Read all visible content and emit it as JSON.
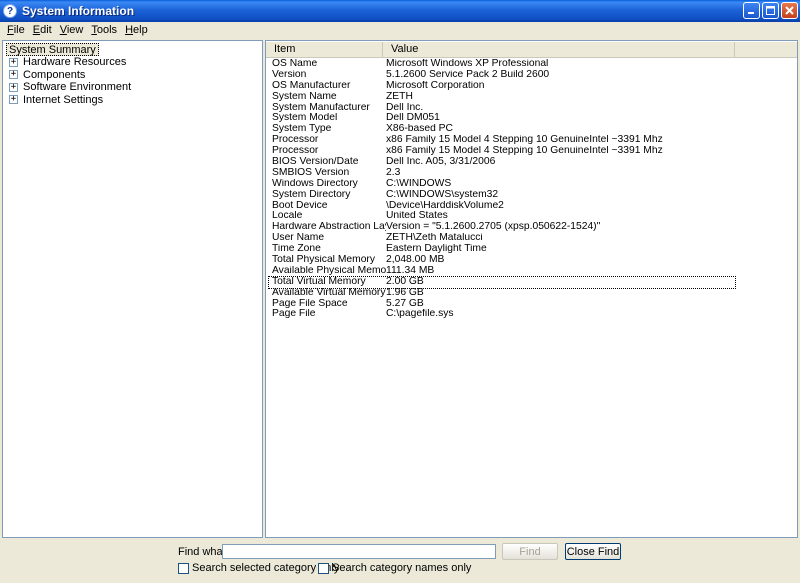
{
  "window": {
    "title": "System Information",
    "icon": "info-app-icon"
  },
  "menu": [
    {
      "label": "File",
      "accel": "F",
      "rest": "ile"
    },
    {
      "label": "Edit",
      "accel": "E",
      "rest": "dit"
    },
    {
      "label": "View",
      "accel": "V",
      "rest": "iew"
    },
    {
      "label": "Tools",
      "accel": "T",
      "rest": "ools"
    },
    {
      "label": "Help",
      "accel": "H",
      "rest": "elp"
    }
  ],
  "tree": {
    "root": "System Summary",
    "nodes": [
      "Hardware Resources",
      "Components",
      "Software Environment",
      "Internet Settings"
    ]
  },
  "table": {
    "columns": [
      "Item",
      "Value"
    ],
    "selected_index": 20,
    "rows": [
      [
        "OS Name",
        "Microsoft Windows XP Professional"
      ],
      [
        "Version",
        "5.1.2600 Service Pack 2 Build 2600"
      ],
      [
        "OS Manufacturer",
        "Microsoft Corporation"
      ],
      [
        "System Name",
        "ZETH"
      ],
      [
        "System Manufacturer",
        "Dell Inc."
      ],
      [
        "System Model",
        "Dell DM051"
      ],
      [
        "System Type",
        "X86-based PC"
      ],
      [
        "Processor",
        "x86 Family 15 Model 4 Stepping 10 GenuineIntel ~3391 Mhz"
      ],
      [
        "Processor",
        "x86 Family 15 Model 4 Stepping 10 GenuineIntel ~3391 Mhz"
      ],
      [
        "BIOS Version/Date",
        "Dell Inc. A05, 3/31/2006"
      ],
      [
        "SMBIOS Version",
        "2.3"
      ],
      [
        "Windows Directory",
        "C:\\WINDOWS"
      ],
      [
        "System Directory",
        "C:\\WINDOWS\\system32"
      ],
      [
        "Boot Device",
        "\\Device\\HarddiskVolume2"
      ],
      [
        "Locale",
        "United States"
      ],
      [
        "Hardware Abstraction Layer",
        "Version = \"5.1.2600.2705 (xpsp.050622-1524)\""
      ],
      [
        "User Name",
        "ZETH\\Zeth Matalucci"
      ],
      [
        "Time Zone",
        "Eastern Daylight Time"
      ],
      [
        "Total Physical Memory",
        "2,048.00 MB"
      ],
      [
        "Available Physical Memory",
        "111.34 MB"
      ],
      [
        "Total Virtual Memory",
        "2.00 GB"
      ],
      [
        "Available Virtual Memory",
        "1.96 GB"
      ],
      [
        "Page File Space",
        "5.27 GB"
      ],
      [
        "Page File",
        "C:\\pagefile.sys"
      ]
    ]
  },
  "find": {
    "label": "Find what:",
    "value": "",
    "find_button": "Find",
    "close_button": "Close Find",
    "option1": "Search selected category only",
    "option2": "Search category names only"
  }
}
